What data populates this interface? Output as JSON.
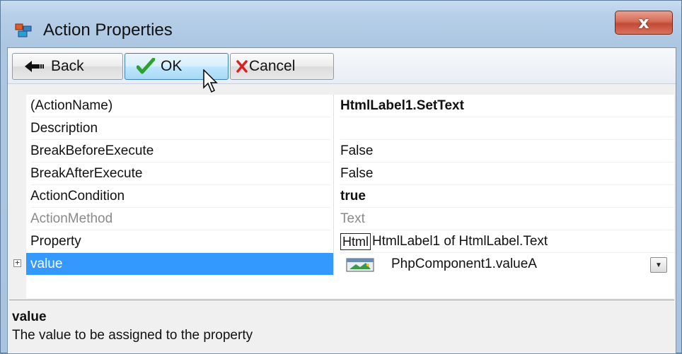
{
  "window": {
    "title": "Action Properties",
    "close_label": "x"
  },
  "toolbar": {
    "back_label": "Back",
    "ok_label": "OK",
    "cancel_label": "Cancel"
  },
  "grid": {
    "rows": [
      {
        "name": "(ActionName)",
        "value": "HtmlLabel1.SetText"
      },
      {
        "name": "Description",
        "value": ""
      },
      {
        "name": "BreakBeforeExecute",
        "value": "False"
      },
      {
        "name": "BreakAfterExecute",
        "value": "False"
      },
      {
        "name": "ActionCondition",
        "value": "true"
      },
      {
        "name": "ActionMethod",
        "value": "Text"
      },
      {
        "name": "Property",
        "value_box": "Html",
        "value": "HtmlLabel1 of HtmlLabel.Text"
      },
      {
        "name": "value",
        "value": "PhpComponent1.valueA"
      }
    ]
  },
  "help": {
    "title": "value",
    "description": "The value to be assigned to the property"
  },
  "colors": {
    "selection": "#3399ff",
    "close_button": "#c34a34"
  },
  "icons": [
    "app-icon",
    "back-arrow-icon",
    "checkmark-icon",
    "cross-icon",
    "mouse-cursor-icon",
    "expand-plus-icon",
    "component-icon",
    "dropdown-arrow-icon"
  ]
}
